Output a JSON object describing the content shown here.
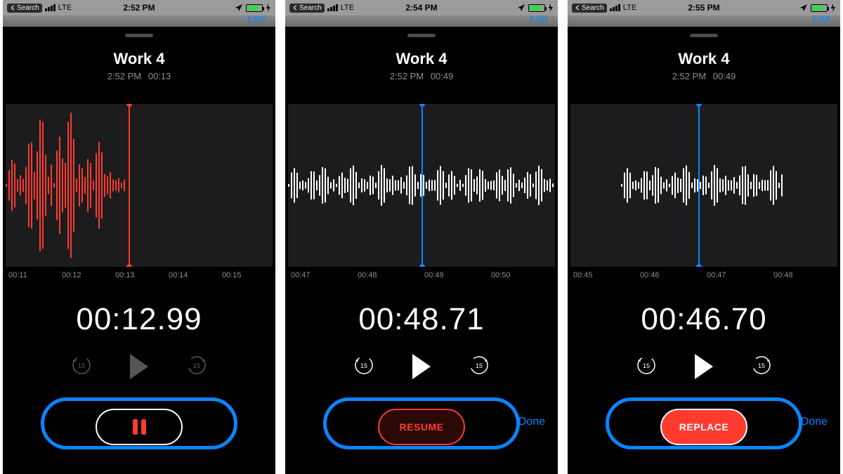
{
  "screens": [
    {
      "statusbar": {
        "back_label": "Search",
        "carrier": "LTE",
        "time": "2:52 PM"
      },
      "edit_label": "Edit",
      "title": "Work 4",
      "subtitle_time": "2:52 PM",
      "subtitle_duration": "00:13",
      "show_crop": false,
      "waveform": {
        "color": "#ff3b30",
        "align": "left",
        "fill_ratio": 0.46,
        "amp_scale": 1.0
      },
      "playhead": {
        "color": "red",
        "pos_pct": 46
      },
      "ruler": [
        "00:11",
        "00:12",
        "00:13",
        "00:14",
        "00:15"
      ],
      "bigtime": "00:12.99",
      "playback_dim": true,
      "action": {
        "kind": "pause",
        "label": ""
      },
      "show_done": false
    },
    {
      "statusbar": {
        "back_label": "Search",
        "carrier": "LTE",
        "time": "2:54 PM"
      },
      "edit_label": "Edit",
      "title": "Work 4",
      "subtitle_time": "2:52 PM",
      "subtitle_duration": "00:49",
      "show_crop": true,
      "waveform": {
        "color": "#ffffff",
        "align": "left",
        "fill_ratio": 1.0,
        "amp_scale": 0.28
      },
      "playhead": {
        "color": "blue",
        "pos_pct": 50
      },
      "ruler": [
        "00:47",
        "00:48",
        "00:49",
        "00:50"
      ],
      "bigtime": "00:48.71",
      "playback_dim": false,
      "action": {
        "kind": "resume",
        "label": "RESUME"
      },
      "show_done": true,
      "done_label": "Done"
    },
    {
      "statusbar": {
        "back_label": "Search",
        "carrier": "LTE",
        "time": "2:55 PM"
      },
      "edit_label": "Edit",
      "title": "Work 4",
      "subtitle_time": "2:52 PM",
      "subtitle_duration": "00:49",
      "show_crop": true,
      "waveform": {
        "color": "#ffffff",
        "align": "center",
        "fill_ratio": 0.62,
        "amp_scale": 0.28
      },
      "playhead": {
        "color": "blue",
        "pos_pct": 48
      },
      "ruler": [
        "00:45",
        "00:46",
        "00:47",
        "00:48"
      ],
      "bigtime": "00:46.70",
      "playback_dim": false,
      "action": {
        "kind": "replace",
        "label": "REPLACE"
      },
      "show_done": true,
      "done_label": "Done"
    }
  ]
}
